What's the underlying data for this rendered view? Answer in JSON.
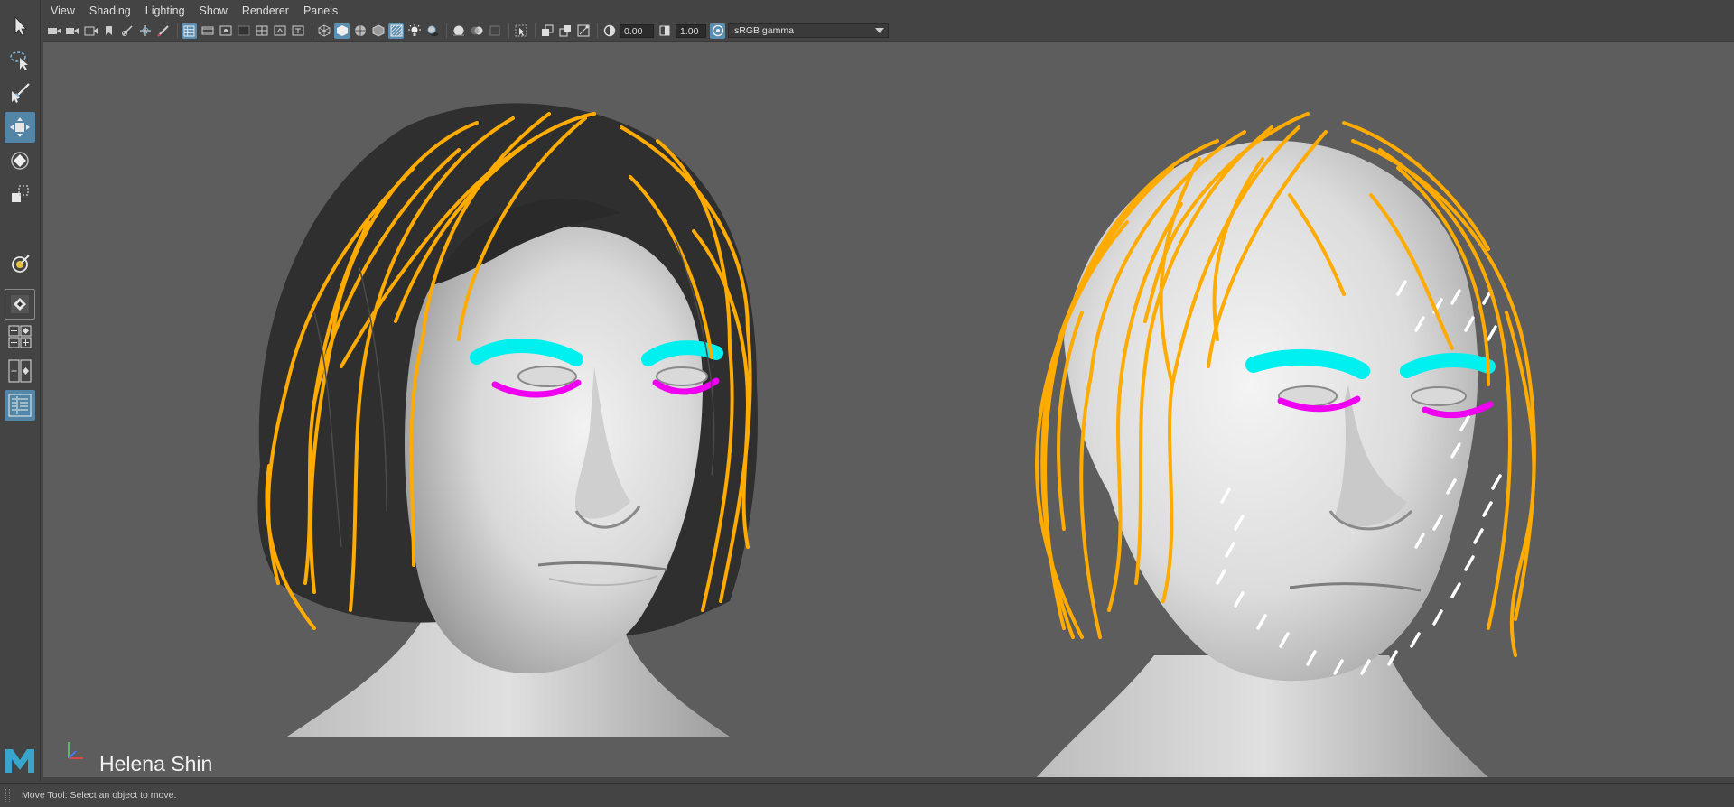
{
  "menubar": {
    "items": [
      "View",
      "Shading",
      "Lighting",
      "Show",
      "Renderer",
      "Panels"
    ]
  },
  "toolbar": {
    "exposure_value": "0.00",
    "gamma_value": "1.00",
    "colorspace": "sRGB gamma"
  },
  "toolbox": {
    "tools": [
      "select-tool",
      "lasso-tool",
      "paint-select-tool",
      "move-tool",
      "rotate-tool",
      "scale-tool",
      "last-used-tool",
      "single-perspective-layout",
      "four-panel-layout",
      "two-panel-layout",
      "outliner-layout"
    ],
    "active_tool": "move-tool"
  },
  "viewport": {
    "watermark": "Helena Shin",
    "colors": {
      "hair_guides": "#ffab00",
      "eyebrows": "#00f0f0",
      "eyelashes": "#f000f0",
      "stubble": "#ffffff",
      "background": "#5d5d5d"
    }
  },
  "statusbar": {
    "message": "Move Tool: Select an object to move."
  }
}
